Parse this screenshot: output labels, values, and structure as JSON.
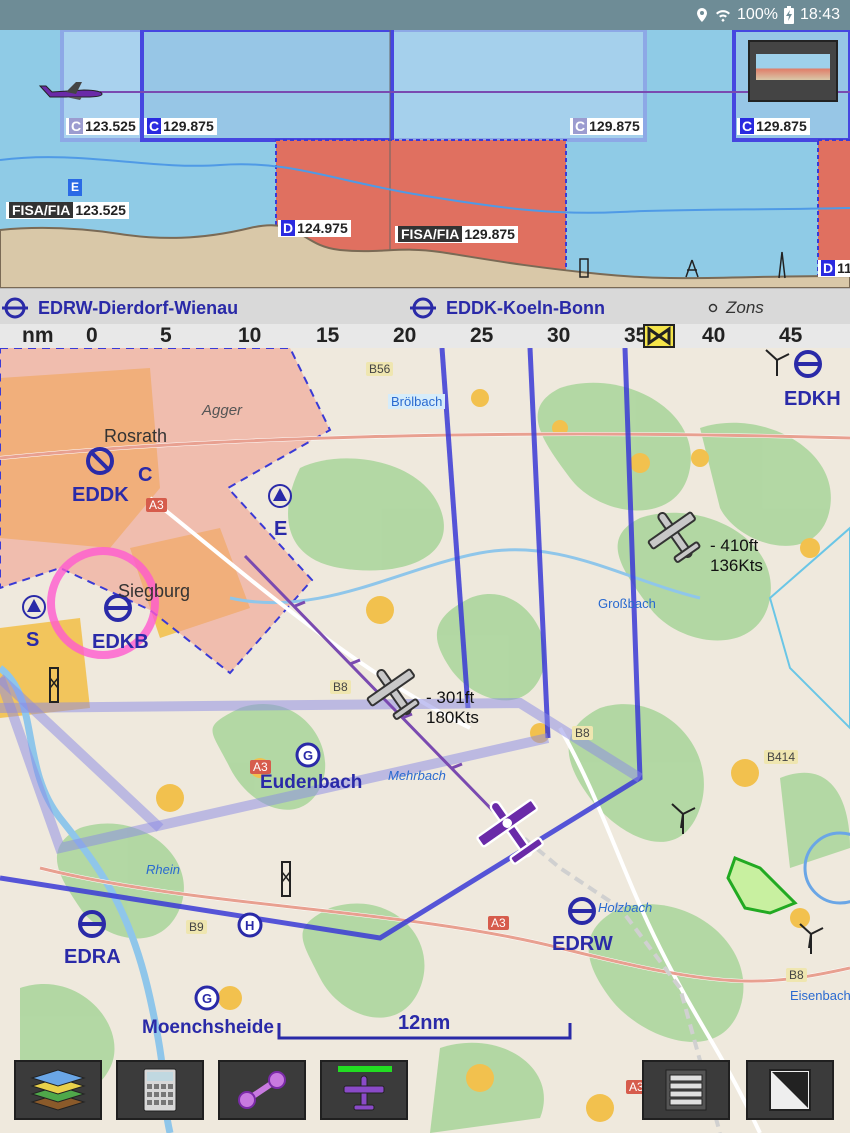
{
  "status": {
    "battery": "100%",
    "time": "18:43"
  },
  "profile": {
    "freq_1": {
      "cls": "C",
      "value": "123.525"
    },
    "freq_2": {
      "cls": "C",
      "value": "129.875"
    },
    "freq_3": {
      "cls": "C",
      "value": "129.875"
    },
    "freq_4": {
      "cls": "C",
      "value": "129.875"
    },
    "freq_5": {
      "cls": "D",
      "value": "124.975"
    },
    "freq_6": {
      "cls": "D",
      "value": "11"
    },
    "fisa_1": {
      "label": "FISA/FIA",
      "value": "123.525"
    },
    "fisa_2": {
      "label": "FISA/FIA",
      "value": "129.875"
    },
    "class_e": "E"
  },
  "route": {
    "from": "EDRW-Dierdorf-Wienau",
    "to": "EDDK-Koeln-Bonn",
    "extra": "Zons"
  },
  "scale": {
    "unit": "nm",
    "ticks": [
      "0",
      "5",
      "10",
      "15",
      "20",
      "25",
      "30",
      "35",
      "40",
      "45"
    ]
  },
  "map": {
    "airports": {
      "eddk": "EDDK",
      "edkb": "EDKB",
      "edra": "EDRA",
      "edrw": "EDRW",
      "edkh": "EDKH"
    },
    "labels": {
      "c": "C",
      "e": "E",
      "s": "S",
      "rosrath": "Rosrath",
      "siegburg": "Siegburg",
      "eudenbach": "Eudenbach",
      "moenchsheide": "Moenchsheide",
      "agger": "Agger",
      "broelbach": "Brölbach",
      "mehrbach": "Mehrbach",
      "holzbach": "Holzbach",
      "grossbach": "Großbach",
      "rhein": "Rhein",
      "eisenbach": "Eisenbach"
    },
    "roads": {
      "b56": "B56",
      "b8a": "B8",
      "b8b": "B8",
      "b8c": "B8",
      "b9": "B9",
      "b414": "B414",
      "a3a": "A3",
      "a3b": "A3",
      "a3c": "A3",
      "a3d": "A3"
    },
    "traffic_1": {
      "alt": "- 301ft",
      "speed": "180Kts"
    },
    "traffic_2": {
      "alt": "- 410ft",
      "speed": "136Kts"
    },
    "scale_bar": "12nm"
  },
  "colors": {
    "airspace_blue": "#3a3ad6",
    "restricted_red": "#e07060",
    "accent_green": "#22dd22",
    "own_plane": "#6a2aa8"
  }
}
